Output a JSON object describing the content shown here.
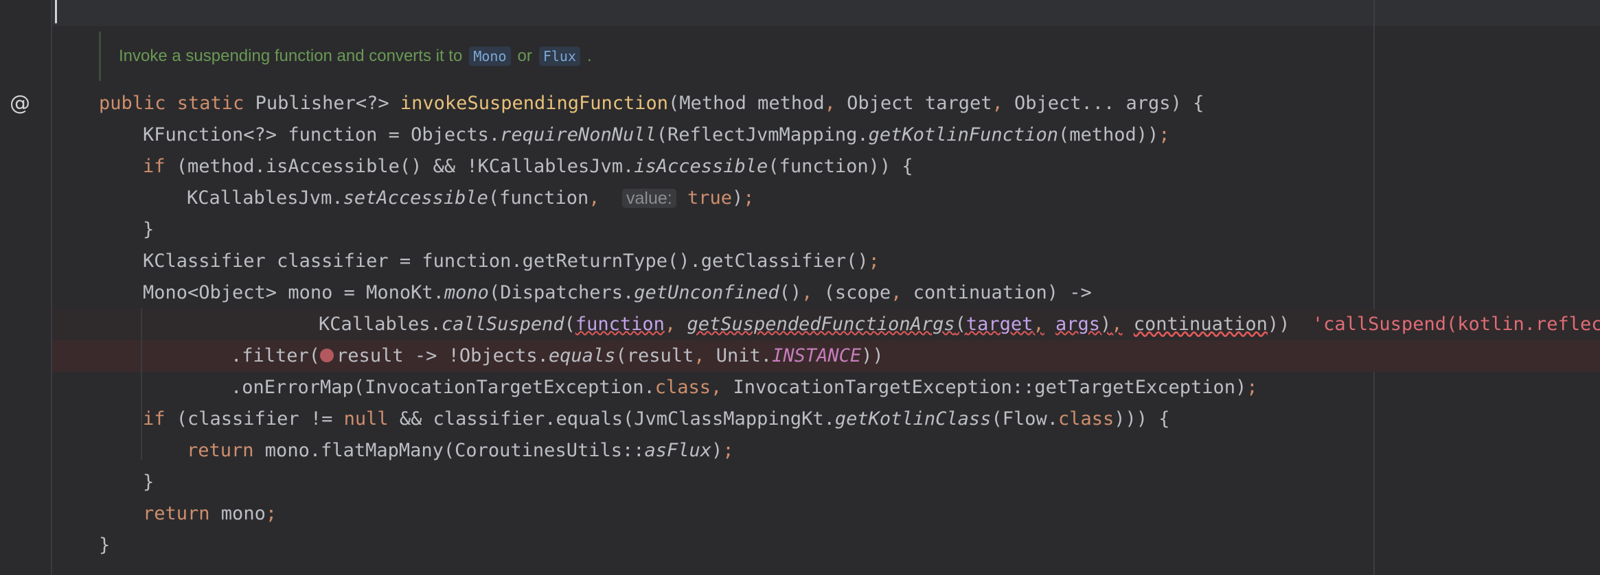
{
  "doc": {
    "text_before": "Invoke a suspending function and converts it to",
    "mono": "Mono",
    "or": "or",
    "flux": "Flux",
    "end": "."
  },
  "gutter": {
    "annotation_icon": "at-icon"
  },
  "colors": {
    "background": "#2b2b2d",
    "keyword": "#cf8e6d",
    "method_decl": "#e8c07a",
    "doc_comment": "#6a9955",
    "error": "#e06c75"
  },
  "code": {
    "l1": {
      "t1": "public static",
      "t2": " Publisher<?> ",
      "t3": "invokeSuspendingFunction",
      "t4": "(Method method",
      "t5": ",",
      "t6": " Object target",
      "t7": ",",
      "t8": " Object... args) {"
    },
    "l2": {
      "t1": "KFunction<?> function = Objects.",
      "t2": "requireNonNull",
      "t3": "(ReflectJvmMapping.",
      "t4": "getKotlinFunction",
      "t5": "(method))",
      "t6": ";"
    },
    "l3": {
      "t1": "if",
      "t2": " (method.isAccessible() && !KCallablesJvm.",
      "t3": "isAccessible",
      "t4": "(function)) {"
    },
    "l4": {
      "t1": "KCallablesJvm.",
      "t2": "setAccessible",
      "t3": "(function",
      "t4": ",",
      "t5": "value:",
      "t6": "true",
      "t7": ")",
      "t8": ";"
    },
    "l5": {
      "t1": "}"
    },
    "l6": {
      "t1": "KClassifier classifier = function.getReturnType().getClassifier()",
      "t2": ";"
    },
    "l7": {
      "t1": "Mono<Object> mono = MonoKt.",
      "t2": "mono",
      "t3": "(Dispatchers.",
      "t4": "getUnconfined",
      "t5": "()",
      "t6": ",",
      "t7": " (scope",
      "t8": ",",
      "t9": " continuation) ->"
    },
    "l8": {
      "t1": "KCallables.",
      "t2": "callSuspend",
      "t3": "(",
      "t4": "function",
      "t5": ",",
      "t6": "getSuspendedFunctionArgs",
      "t7": "(",
      "t8": "target",
      "t9": ",",
      "t10": "args",
      "t11": ")",
      "t12": ",",
      "t13": "continuation",
      "t14": "))",
      "t15": "'callSuspend(kotlin.reflect.KC"
    },
    "l9": {
      "t1": ".filter(",
      "t2": "result -> !Objects.",
      "t3": "equals",
      "t4": "(result",
      "t5": ",",
      "t6": " Unit.",
      "t7": "INSTANCE",
      "t8": "))"
    },
    "l10": {
      "t1": ".onErrorMap(InvocationTargetException.",
      "t2": "class",
      "t3": ",",
      "t4": " InvocationTargetException::getTargetException)",
      "t5": ";"
    },
    "l11": {
      "t1": "if",
      "t2": " (classifier != ",
      "t3": "null",
      "t4": " && classifier.equals(JvmClassMappingKt.",
      "t5": "getKotlinClass",
      "t6": "(Flow.",
      "t7": "class",
      "t8": "))) {"
    },
    "l12": {
      "t1": "return",
      "t2": " mono.flatMapMany(CoroutinesUtils::",
      "t3": "asFlux",
      "t4": ")",
      "t5": ";"
    },
    "l13": {
      "t1": "}"
    },
    "l14": {
      "t1": "return",
      "t2": " mono",
      "t3": ";"
    },
    "l15": {
      "t1": "}"
    }
  }
}
